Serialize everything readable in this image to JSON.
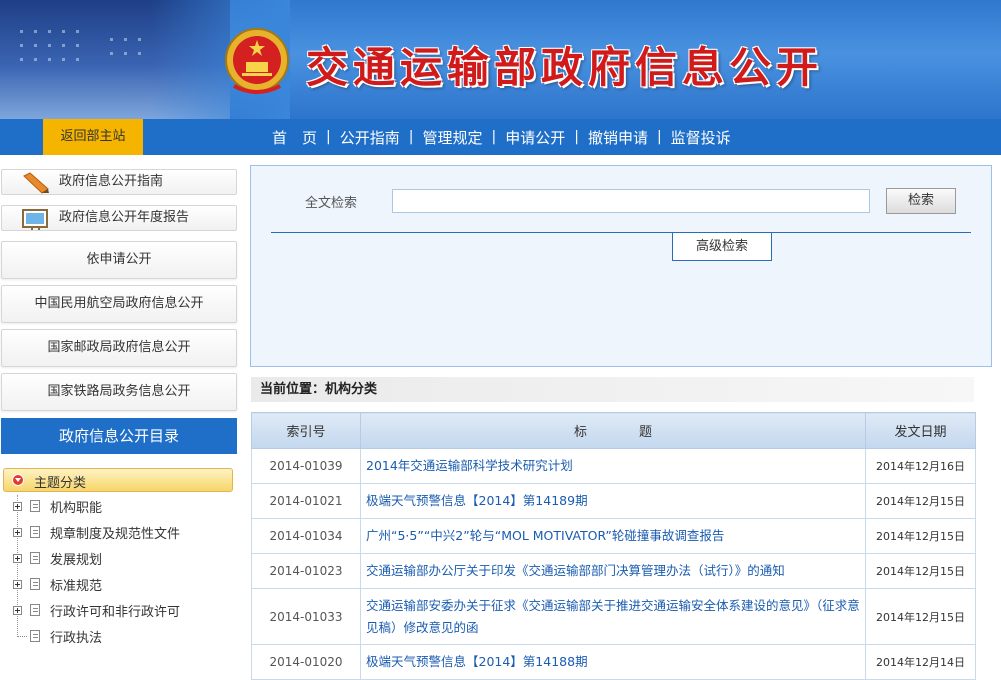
{
  "header": {
    "site_title": "交通运输部政府信息公开"
  },
  "nav": {
    "back_label": "返回部主站",
    "links": [
      "首　页",
      "公开指南",
      "管理规定",
      "申请公开",
      "撤销申请",
      "监督投诉"
    ]
  },
  "sidebar": {
    "guide_label": "政府信息公开指南",
    "annual_label": "政府信息公开年度报告",
    "tabs": [
      "依申请公开",
      "中国民用航空局政府信息公开",
      "国家邮政局政府信息公开",
      "国家铁路局政务信息公开"
    ],
    "catalog_title": "政府信息公开目录",
    "topic_label": "主题分类",
    "tree_items": [
      "机构职能",
      "规章制度及规范性文件",
      "发展规划",
      "标准规范",
      "行政许可和非行政许可",
      "行政执法"
    ]
  },
  "search": {
    "label": "全文检索",
    "value": "",
    "button": "检索",
    "advanced": "高级检索"
  },
  "breadcrumb": {
    "text": "当前位置：机构分类"
  },
  "table": {
    "headers": [
      "索引号",
      "标　　　　题",
      "发文日期"
    ],
    "rows": [
      {
        "index": "2014-01039",
        "title": "2014年交通运输部科学技术研究计划",
        "date": "2014年12月16日"
      },
      {
        "index": "2014-01021",
        "title": "极端天气预警信息【2014】第14189期",
        "date": "2014年12月15日"
      },
      {
        "index": "2014-01034",
        "title": "广州“5·5”“中兴2”轮与“MOL MOTIVATOR”轮碰撞事故调查报告",
        "date": "2014年12月15日"
      },
      {
        "index": "2014-01023",
        "title": "交通运输部办公厅关于印发《交通运输部部门决算管理办法（试行）》的通知",
        "date": "2014年12月15日"
      },
      {
        "index": "2014-01033",
        "title": "交通运输部安委办关于征求《交通运输部关于推进交通运输安全体系建设的意见》（征求意见稿）修改意见的函",
        "date": "2014年12月15日"
      },
      {
        "index": "2014-01020",
        "title": "极端天气预警信息【2014】第14188期",
        "date": "2014年12月14日"
      }
    ]
  },
  "colors": {
    "nav_blue": "#1f6fc8",
    "back_button": "#f5b400",
    "title_red": "#d11a1a",
    "link_blue": "#1a5cb0"
  }
}
